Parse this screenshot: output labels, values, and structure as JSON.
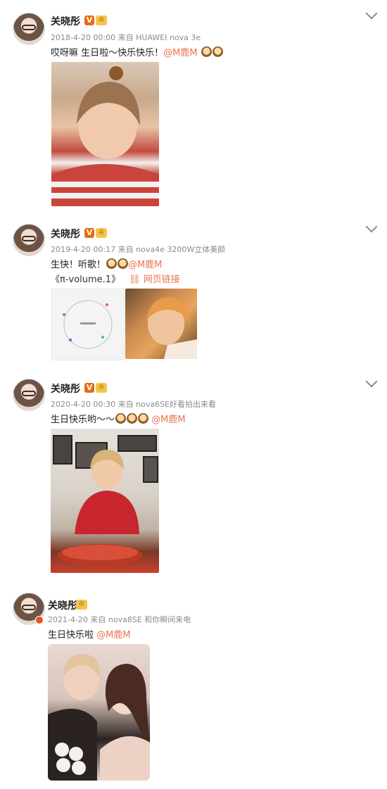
{
  "posts": [
    {
      "user": "关晓彤",
      "meta": "2018-4-20 00:00 来自 HUAWEI nova 3e",
      "text": "哎呀嘛 生日啦～快乐快乐！",
      "mention": "@M鹿M"
    },
    {
      "user": "关晓彤",
      "meta": "2019-4-20 00:17 来自 nova4e 3200W立体美颜",
      "text": "生快！听歌！",
      "mention": "@M鹿M",
      "album": "《π-volume.1》",
      "web_link": "网页链接"
    },
    {
      "user": "关晓彤",
      "meta": "2020-4-20 00:30 来自 nova6SE好看拍出来看",
      "text": "生日快乐哟～～",
      "mention": "@M鹿M"
    },
    {
      "user": "关晓彤",
      "meta": "2021-4-20 来自 nova8SE 和你瞬间来电",
      "text": "生日快乐啦",
      "mention": "@M鹿M"
    }
  ],
  "icons": {
    "verified": "V",
    "crown": "♔"
  },
  "colors": {
    "mention": "#eb7350",
    "meta": "#8a8a8a",
    "badge": "#e86a10"
  }
}
